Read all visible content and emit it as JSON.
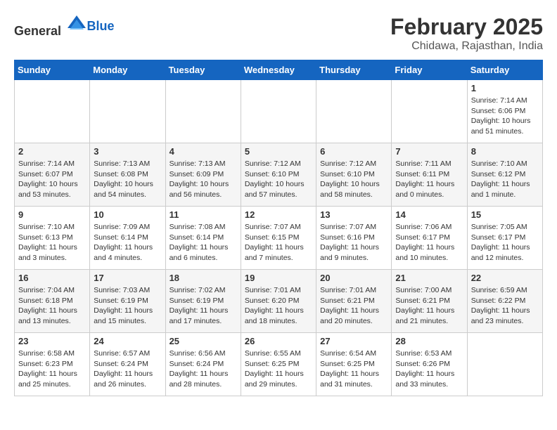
{
  "header": {
    "logo_general": "General",
    "logo_blue": "Blue",
    "month": "February 2025",
    "location": "Chidawa, Rajasthan, India"
  },
  "weekdays": [
    "Sunday",
    "Monday",
    "Tuesday",
    "Wednesday",
    "Thursday",
    "Friday",
    "Saturday"
  ],
  "weeks": [
    [
      {
        "day": "",
        "info": ""
      },
      {
        "day": "",
        "info": ""
      },
      {
        "day": "",
        "info": ""
      },
      {
        "day": "",
        "info": ""
      },
      {
        "day": "",
        "info": ""
      },
      {
        "day": "",
        "info": ""
      },
      {
        "day": "1",
        "info": "Sunrise: 7:14 AM\nSunset: 6:06 PM\nDaylight: 10 hours and 51 minutes."
      }
    ],
    [
      {
        "day": "2",
        "info": "Sunrise: 7:14 AM\nSunset: 6:07 PM\nDaylight: 10 hours and 53 minutes."
      },
      {
        "day": "3",
        "info": "Sunrise: 7:13 AM\nSunset: 6:08 PM\nDaylight: 10 hours and 54 minutes."
      },
      {
        "day": "4",
        "info": "Sunrise: 7:13 AM\nSunset: 6:09 PM\nDaylight: 10 hours and 56 minutes."
      },
      {
        "day": "5",
        "info": "Sunrise: 7:12 AM\nSunset: 6:10 PM\nDaylight: 10 hours and 57 minutes."
      },
      {
        "day": "6",
        "info": "Sunrise: 7:12 AM\nSunset: 6:10 PM\nDaylight: 10 hours and 58 minutes."
      },
      {
        "day": "7",
        "info": "Sunrise: 7:11 AM\nSunset: 6:11 PM\nDaylight: 11 hours and 0 minutes."
      },
      {
        "day": "8",
        "info": "Sunrise: 7:10 AM\nSunset: 6:12 PM\nDaylight: 11 hours and 1 minute."
      }
    ],
    [
      {
        "day": "9",
        "info": "Sunrise: 7:10 AM\nSunset: 6:13 PM\nDaylight: 11 hours and 3 minutes."
      },
      {
        "day": "10",
        "info": "Sunrise: 7:09 AM\nSunset: 6:14 PM\nDaylight: 11 hours and 4 minutes."
      },
      {
        "day": "11",
        "info": "Sunrise: 7:08 AM\nSunset: 6:14 PM\nDaylight: 11 hours and 6 minutes."
      },
      {
        "day": "12",
        "info": "Sunrise: 7:07 AM\nSunset: 6:15 PM\nDaylight: 11 hours and 7 minutes."
      },
      {
        "day": "13",
        "info": "Sunrise: 7:07 AM\nSunset: 6:16 PM\nDaylight: 11 hours and 9 minutes."
      },
      {
        "day": "14",
        "info": "Sunrise: 7:06 AM\nSunset: 6:17 PM\nDaylight: 11 hours and 10 minutes."
      },
      {
        "day": "15",
        "info": "Sunrise: 7:05 AM\nSunset: 6:17 PM\nDaylight: 11 hours and 12 minutes."
      }
    ],
    [
      {
        "day": "16",
        "info": "Sunrise: 7:04 AM\nSunset: 6:18 PM\nDaylight: 11 hours and 13 minutes."
      },
      {
        "day": "17",
        "info": "Sunrise: 7:03 AM\nSunset: 6:19 PM\nDaylight: 11 hours and 15 minutes."
      },
      {
        "day": "18",
        "info": "Sunrise: 7:02 AM\nSunset: 6:19 PM\nDaylight: 11 hours and 17 minutes."
      },
      {
        "day": "19",
        "info": "Sunrise: 7:01 AM\nSunset: 6:20 PM\nDaylight: 11 hours and 18 minutes."
      },
      {
        "day": "20",
        "info": "Sunrise: 7:01 AM\nSunset: 6:21 PM\nDaylight: 11 hours and 20 minutes."
      },
      {
        "day": "21",
        "info": "Sunrise: 7:00 AM\nSunset: 6:21 PM\nDaylight: 11 hours and 21 minutes."
      },
      {
        "day": "22",
        "info": "Sunrise: 6:59 AM\nSunset: 6:22 PM\nDaylight: 11 hours and 23 minutes."
      }
    ],
    [
      {
        "day": "23",
        "info": "Sunrise: 6:58 AM\nSunset: 6:23 PM\nDaylight: 11 hours and 25 minutes."
      },
      {
        "day": "24",
        "info": "Sunrise: 6:57 AM\nSunset: 6:24 PM\nDaylight: 11 hours and 26 minutes."
      },
      {
        "day": "25",
        "info": "Sunrise: 6:56 AM\nSunset: 6:24 PM\nDaylight: 11 hours and 28 minutes."
      },
      {
        "day": "26",
        "info": "Sunrise: 6:55 AM\nSunset: 6:25 PM\nDaylight: 11 hours and 29 minutes."
      },
      {
        "day": "27",
        "info": "Sunrise: 6:54 AM\nSunset: 6:25 PM\nDaylight: 11 hours and 31 minutes."
      },
      {
        "day": "28",
        "info": "Sunrise: 6:53 AM\nSunset: 6:26 PM\nDaylight: 11 hours and 33 minutes."
      },
      {
        "day": "",
        "info": ""
      }
    ]
  ]
}
